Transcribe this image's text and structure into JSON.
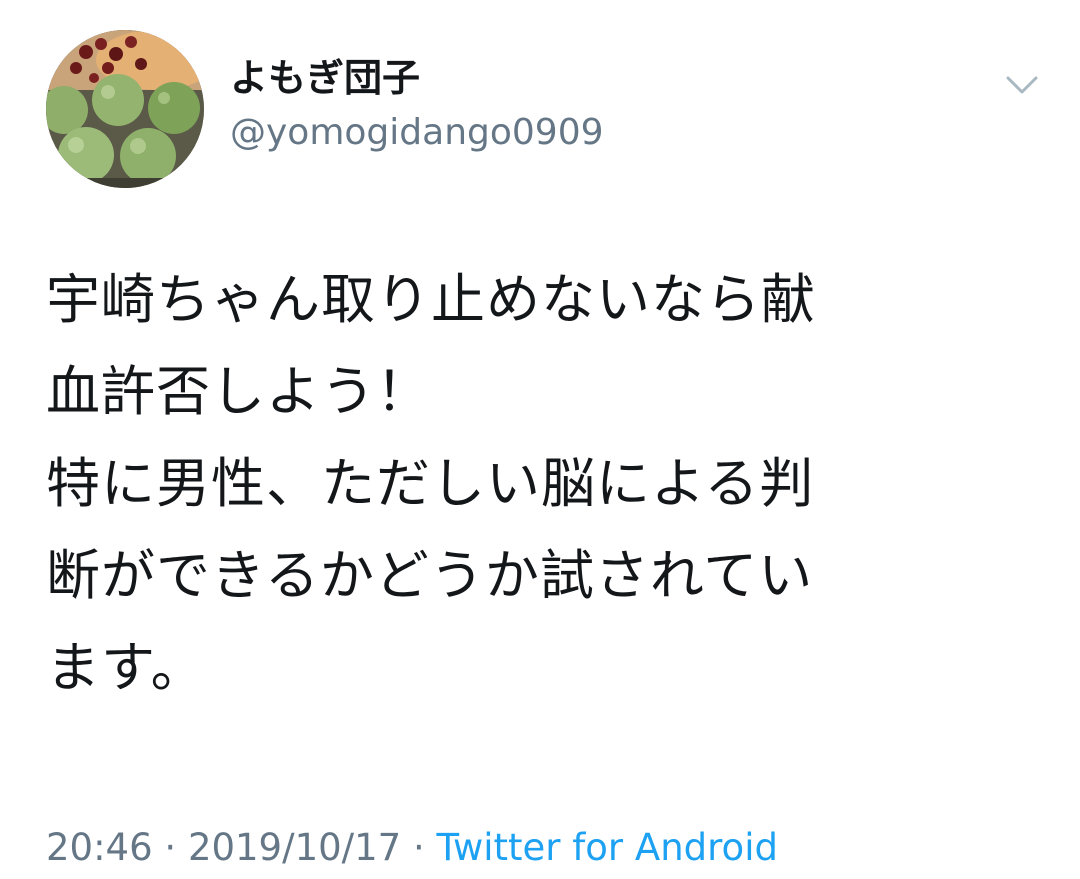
{
  "user": {
    "display_name": "よもぎ団子",
    "handle": "@yomogidango0909",
    "avatar_icon": "avatar-dango-photo"
  },
  "menu": {
    "caret_icon": "chevron-down-icon"
  },
  "tweet": {
    "lines": [
      "宇崎ちゃん取り止めないなら献",
      "血許否しよう！",
      "特に男性、ただしい脳による判",
      "断ができるかどうか試されてい",
      "ます。"
    ]
  },
  "meta": {
    "time": "20:46",
    "separator": " · ",
    "date": "2019/10/17",
    "source": "Twitter for Android"
  },
  "colors": {
    "text": "#14171a",
    "secondary": "#657786",
    "link": "#1da1f2"
  }
}
